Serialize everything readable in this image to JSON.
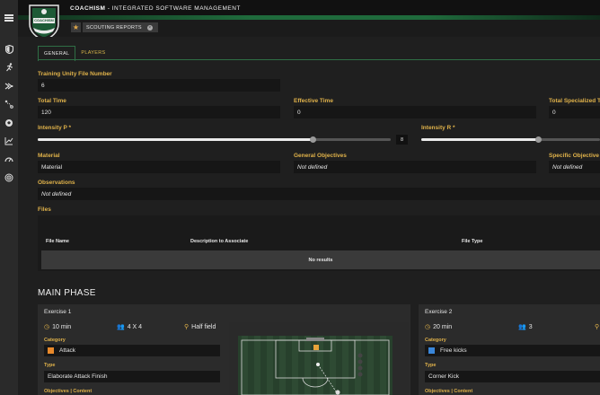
{
  "header": {
    "app_name_prefix": "COACH",
    "app_name_suffix": "ISM",
    "app_title_rest": " - INTEGRATED SOFTWARE MANAGEMENT",
    "logo_text": "COACHISM"
  },
  "toolbar": {
    "chip_label": "SCOUTING REPORTS",
    "chip_close": "×"
  },
  "rail": {
    "icons": [
      "menu-icon",
      "shield-icon",
      "runner-icon",
      "drill-icon",
      "tactics-icon",
      "ball-icon",
      "chart-icon",
      "speedometer-icon",
      "target-icon"
    ]
  },
  "tabs": [
    {
      "label": "GENERAL",
      "active": true
    },
    {
      "label": "PLAYERS",
      "active": false
    }
  ],
  "form": {
    "training_unity_label": "Training Unity File Number",
    "training_unity_value": "6",
    "total_time_label": "Total Time",
    "total_time_value": "120",
    "effective_time_label": "Effective Time",
    "effective_time_value": "0",
    "total_specialized_label": "Total Specialized T",
    "total_specialized_value": "0",
    "intensity_p_label": "Intensity P *",
    "intensity_p_value": "8",
    "intensity_p_fraction": 0.8,
    "intensity_r_label": "Intensity R *",
    "material_label": "Material",
    "material_value": "Material",
    "general_objectives_label": "General Objectives",
    "general_objectives_value": "Not defined",
    "specific_objectives_label": "Specific Objective",
    "specific_objectives_value": "Not defined",
    "observations_label": "Observations",
    "observations_value": "Not defined",
    "files_label": "Files"
  },
  "files_table": {
    "columns": [
      "File Name",
      "Description to Associate",
      "File Type"
    ],
    "empty_text": "No results"
  },
  "main_phase": {
    "title": "MAIN PHASE",
    "exercises": [
      {
        "title": "Exercise 1",
        "duration": "10 min",
        "players": "4 X 4",
        "field": "Half field",
        "category_label": "Category",
        "category_value": "Attack",
        "category_color": "#e8892b",
        "type_label": "Type",
        "type_value": "Elaborate Attack Finish",
        "objectives_label": "Objectives | Content"
      },
      {
        "title": "Exercise 2",
        "duration": "20 min",
        "players": "3",
        "category_label": "Category",
        "category_value": "Free kicks",
        "category_color": "#3a86d9",
        "type_label": "Type",
        "type_value": "Corner Kick",
        "objectives_label": "Objectives | Content"
      }
    ]
  },
  "colors": {
    "accent_gold": "#e0b24a",
    "brand_green": "#1f6b3c"
  }
}
